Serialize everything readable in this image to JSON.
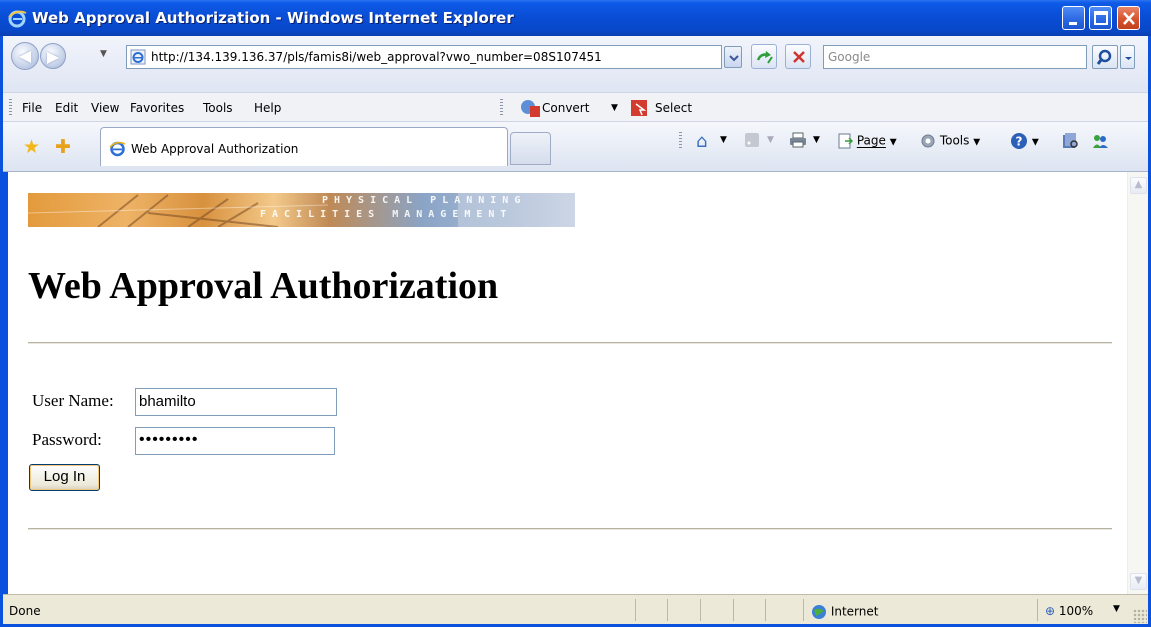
{
  "window": {
    "title": "Web Approval Authorization - Windows Internet Explorer"
  },
  "address_bar": {
    "url": "http://134.139.136.37/pls/famis8i/web_approval?vwo_number=08S107451",
    "search_placeholder": "Google"
  },
  "menu": {
    "items": [
      "File",
      "Edit",
      "View",
      "Favorites",
      "Tools",
      "Help"
    ],
    "convert_label": "Convert",
    "select_label": "Select"
  },
  "tabs": {
    "active_label": "Web Approval Authorization"
  },
  "command_bar": {
    "page_label": "Page",
    "tools_label": "Tools"
  },
  "page": {
    "banner_line1": "PHYSICAL PLANNING",
    "banner_line2": "FACILITIES MANAGEMENT",
    "heading": "Web Approval Authorization",
    "username_label": "User Name:",
    "username_value": "bhamilto",
    "password_label": "Password:",
    "password_value": "•••••••••",
    "login_label": "Log In"
  },
  "status_bar": {
    "status": "Done",
    "zone": "Internet",
    "zoom": "100%"
  },
  "colors": {
    "titlebar": "#0a4fd8",
    "frame": "#0a52dd",
    "statusbar": "#ece9d8"
  }
}
